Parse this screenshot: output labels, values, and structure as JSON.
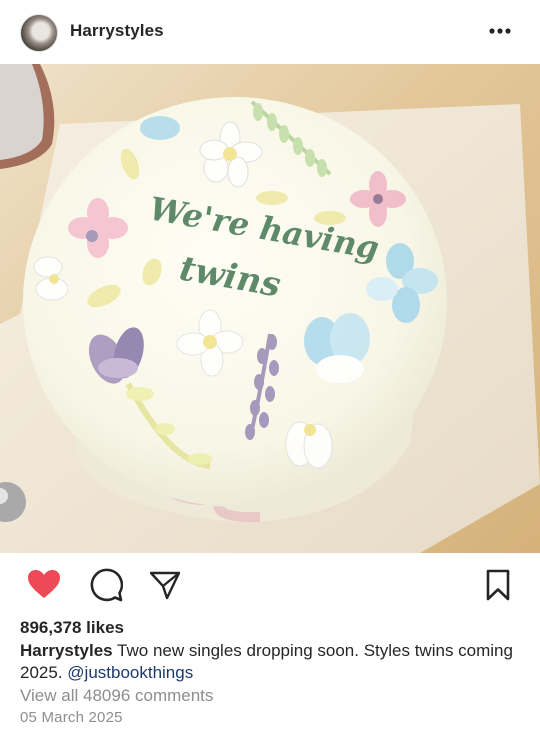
{
  "post": {
    "username": "Harrystyles",
    "image": {
      "cake_text_line1": "We're having",
      "cake_text_line2": "twins"
    },
    "likes": "896,378 likes",
    "caption": {
      "username": "Harrystyles",
      "text": "Two new singles dropping soon. Styles twins coming 2025.",
      "mention": "@justbookthings"
    },
    "view_comments": "View all 48096 comments",
    "date": "05 March 2025"
  },
  "colors": {
    "like_red": "#ed4956",
    "text": "#262626",
    "muted": "#8e8e8e",
    "mention": "#1e3a6d",
    "icing_green": "#5f8a6a"
  },
  "icons": [
    "more-icon",
    "heart-icon",
    "comment-icon",
    "share-icon",
    "bookmark-icon"
  ]
}
